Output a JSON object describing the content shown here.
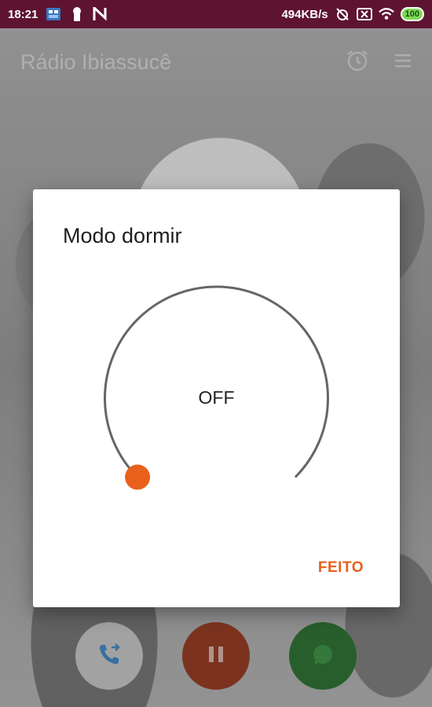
{
  "status_bar": {
    "time": "18:21",
    "net_speed": "494KB/s",
    "battery": "100",
    "left_icons": [
      "app-notification-icon",
      "keyhole-icon",
      "n-app-icon"
    ],
    "right_icons": [
      "alarm-off-icon",
      "close-box-icon",
      "wifi-icon",
      "battery-icon"
    ]
  },
  "app": {
    "title": "Rádio Ibiassucê",
    "header_icons": [
      "alarm-icon",
      "menu-icon"
    ],
    "controls": [
      "call-forward-icon",
      "pause-icon",
      "whatsapp-icon"
    ]
  },
  "dialog": {
    "title": "Modo dormir",
    "dial_value": "OFF",
    "dial_level": 0,
    "done_label": "FEITO",
    "accent_color": "#e8601c",
    "track_color": "#666666"
  }
}
